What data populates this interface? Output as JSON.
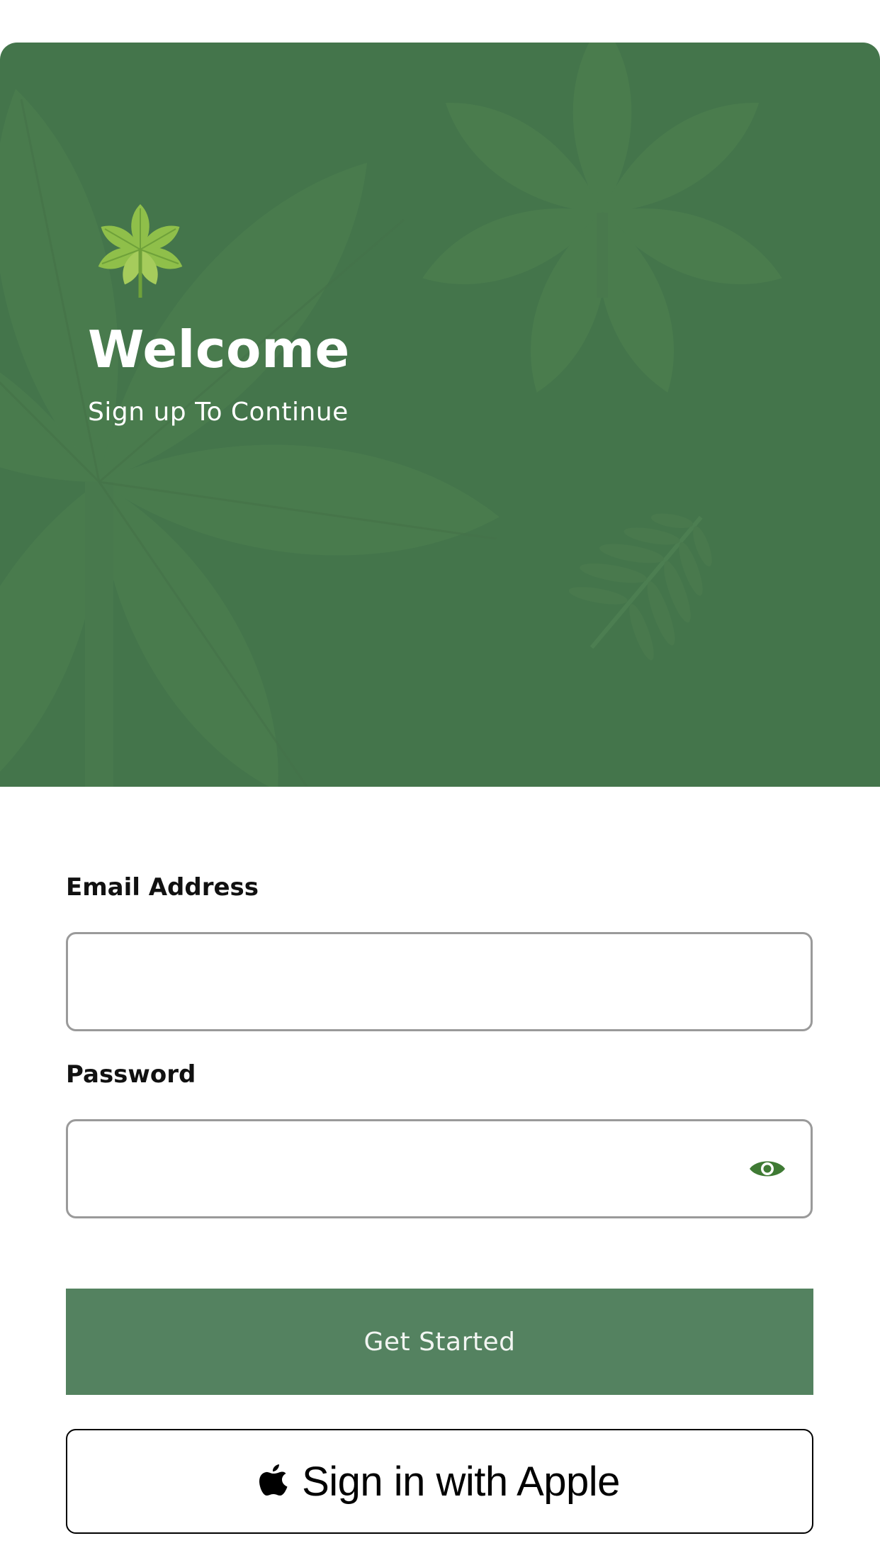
{
  "app": {
    "brand_color": "#44754b",
    "logo_icon": "chestnut-leaf-icon"
  },
  "hero": {
    "title": "Welcome",
    "subtitle": "Sign up To Continue"
  },
  "form": {
    "email": {
      "label": "Email Address",
      "value": "",
      "placeholder": ""
    },
    "password": {
      "label": "Password",
      "value": "",
      "placeholder": "",
      "toggle_icon": "eye-icon"
    }
  },
  "actions": {
    "primary_label": "Get Started",
    "primary_color": "#548260",
    "apple_label": "Sign in with Apple",
    "apple_icon": "apple-icon"
  }
}
